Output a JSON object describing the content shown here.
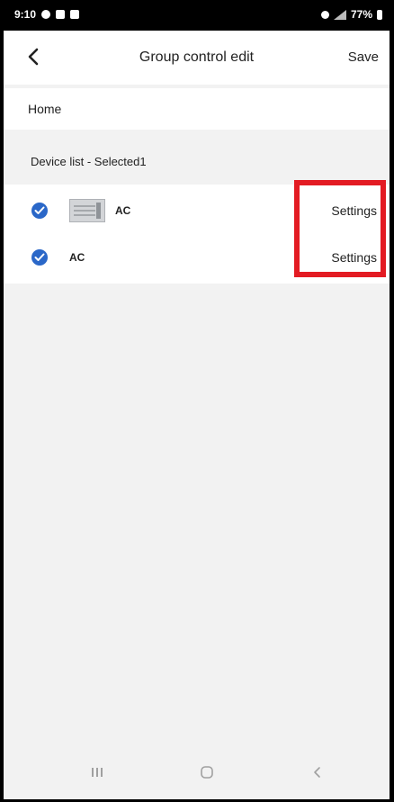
{
  "status_bar": {
    "time": "9:10",
    "battery": "77%"
  },
  "header": {
    "back_icon": "chevron-left-icon",
    "title": "Group control edit",
    "save_label": "Save"
  },
  "home": {
    "label": "Home"
  },
  "device_section": {
    "label": "Device list - Selected1"
  },
  "devices": [
    {
      "name": "AC",
      "checked": true,
      "has_thumbnail": true,
      "settings_label": "Settings"
    },
    {
      "name": "AC",
      "checked": true,
      "has_thumbnail": false,
      "settings_label": "Settings"
    }
  ],
  "nav_bar": {
    "items": [
      "recent-apps-icon",
      "home-icon",
      "back-icon"
    ]
  },
  "colors": {
    "accent_check": "#2a67c8",
    "highlight": "#e31b23",
    "background": "#f2f2f2"
  }
}
